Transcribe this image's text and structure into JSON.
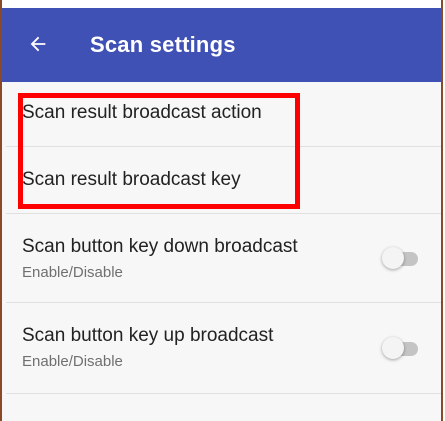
{
  "app_bar": {
    "title": "Scan settings",
    "background": "#3f51b5",
    "back_icon": "arrow-back-icon"
  },
  "preferences": [
    {
      "title": "Scan result broadcast action"
    },
    {
      "title": "Scan result broadcast key"
    },
    {
      "title": "Scan button key down broadcast",
      "summary": "Enable/Disable",
      "toggle_on": false
    },
    {
      "title": "Scan button key up broadcast",
      "summary": "Enable/Disable",
      "toggle_on": false
    }
  ],
  "highlight_color": "#ff0000"
}
